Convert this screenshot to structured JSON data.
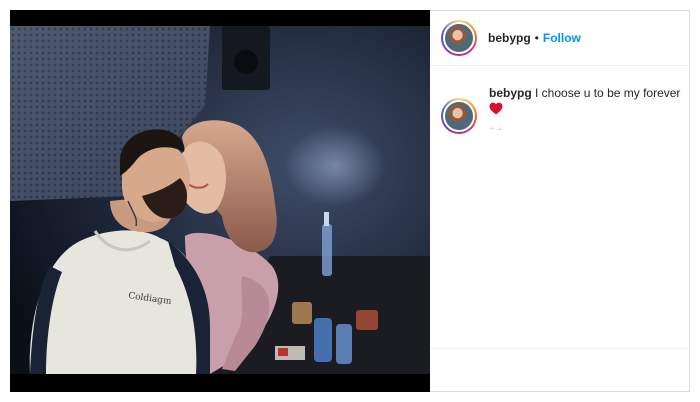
{
  "post": {
    "username": "bebypg",
    "follow_label": "Follow",
    "separator": "•",
    "caption": {
      "username": "bebypg",
      "text": "I choose u to be my forever",
      "emoji": "heart-emoji"
    },
    "comment_meta": "2 d"
  },
  "colors": {
    "follow": "#0095f6",
    "heart": "#d8102e",
    "text": "#262626"
  }
}
